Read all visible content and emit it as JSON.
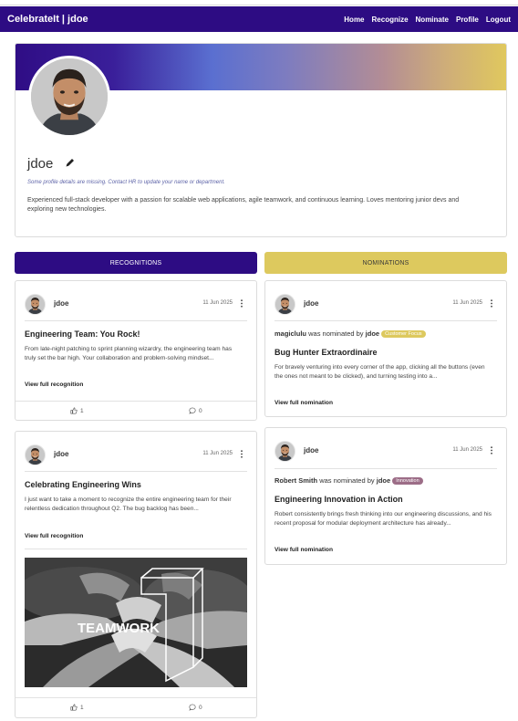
{
  "navbar": {
    "brand": "CelebrateIt | jdoe",
    "links": [
      "Home",
      "Recognize",
      "Nominate",
      "Profile",
      "Logout"
    ]
  },
  "profile": {
    "username": "jdoe",
    "missing_notice": "Some profile details are missing. Contact HR to update your name or department.",
    "bio": "Experienced full-stack developer with a passion for scalable web applications, agile teamwork, and continuous learning. Loves mentoring junior devs and exploring new technologies."
  },
  "tabs": {
    "recognitions": "RECOGNITIONS",
    "nominations": "NOMINATIONS"
  },
  "recognitions": [
    {
      "author": "jdoe",
      "date": "11 Jun 2025",
      "title": "Engineering Team: You Rock!",
      "body": "From late-night patching to sprint planning wizardry, the engineering team has truly set the bar high. Your collaboration and problem-solving mindset...",
      "link": "View full recognition",
      "likes": "1",
      "comments": "0"
    },
    {
      "author": "jdoe",
      "date": "11 Jun 2025",
      "title": "Celebrating Engineering Wins",
      "body": "I just want to take a moment to recognize the entire engineering team for their relentless dedication throughout Q2. The bug backlog has been...",
      "link": "View full recognition",
      "image_text": "TEAMWORK",
      "likes": "1",
      "comments": "0"
    }
  ],
  "nominations": [
    {
      "author": "jdoe",
      "date": "11 Jun 2025",
      "nominee": "magiclulu",
      "was_nominated_by": "was nominated by",
      "nominator": "jdoe",
      "category": "Customer Focus",
      "category_color": "#ddc95e",
      "title": "Bug Hunter Extraordinaire",
      "body": "For bravely venturing into every corner of the app, clicking all the buttons (even the ones not meant to be clicked), and turning testing into a...",
      "link": "View full nomination"
    },
    {
      "author": "jdoe",
      "date": "11 Jun 2025",
      "nominee": "Robert Smith",
      "was_nominated_by": "was nominated by",
      "nominator": "jdoe",
      "category": "Innovation",
      "category_color": "#9c6d87",
      "title": "Engineering Innovation in Action",
      "body": "Robert consistently brings fresh thinking into our engineering discussions, and his recent proposal for modular deployment architecture has already...",
      "link": "View full nomination"
    }
  ],
  "colors": {
    "primary": "#2d0c83",
    "accent": "#ddc95e"
  },
  "icons": {
    "edit": "pencil-icon",
    "more": "kebab-menu-icon",
    "like": "thumbs-up-icon",
    "comment": "comment-icon"
  }
}
